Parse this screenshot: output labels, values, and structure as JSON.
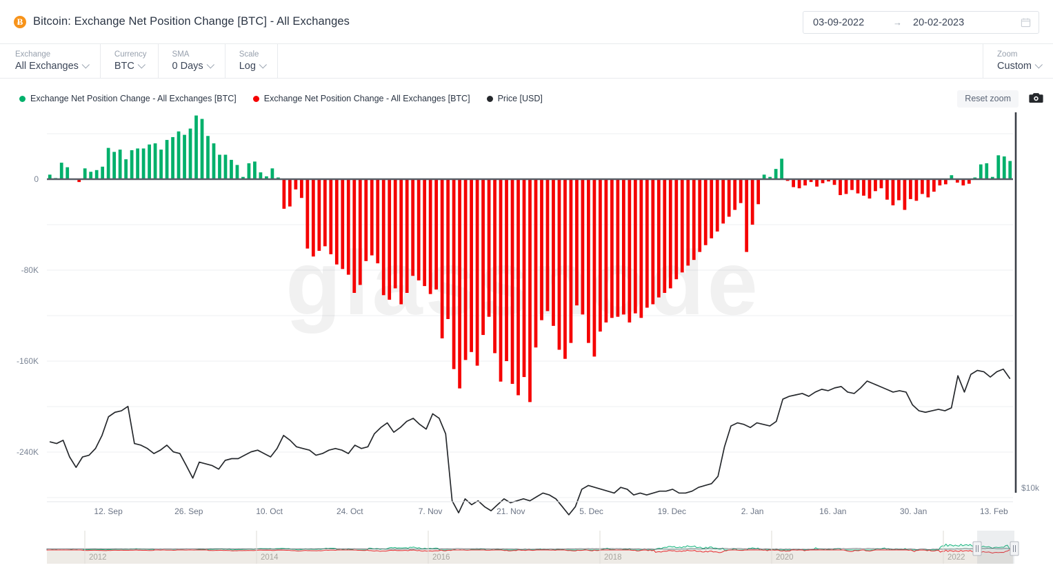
{
  "header": {
    "title": "Bitcoin: Exchange Net Position Change [BTC] - All Exchanges",
    "coin_symbol": "Ƀ"
  },
  "daterange": {
    "from": "03-09-2022",
    "to": "20-02-2023",
    "arrow": "→",
    "calendar_icon": "calendar-icon"
  },
  "controls": [
    {
      "label": "Exchange",
      "value": "All Exchanges"
    },
    {
      "label": "Currency",
      "value": "BTC"
    },
    {
      "label": "SMA",
      "value": "0 Days"
    },
    {
      "label": "Scale",
      "value": "Log"
    }
  ],
  "zoom_control": {
    "label": "Zoom",
    "value": "Custom"
  },
  "legend": [
    {
      "label": "Exchange Net Position Change - All Exchanges [BTC]",
      "color": "#00b06b"
    },
    {
      "label": "Exchange Net Position Change - All Exchanges [BTC]",
      "color": "#f50000"
    },
    {
      "label": "Price [USD]",
      "color": "#25282c"
    }
  ],
  "toolbar": {
    "reset_zoom_label": "Reset zoom",
    "camera_icon": "camera-icon"
  },
  "watermark": "glassnode",
  "chart_data": {
    "type": "bar",
    "title": "Bitcoin: Exchange Net Position Change [BTC] - All Exchanges",
    "xlabel": "",
    "ylabel": "",
    "ylim": [
      -280000,
      60000
    ],
    "yticks": [
      0,
      -80000,
      -160000,
      -240000
    ],
    "ytick_labels": [
      "0",
      "-80K",
      "-160K",
      "-240K"
    ],
    "xticks": [
      "12. Sep",
      "26. Sep",
      "10. Oct",
      "24. Oct",
      "7. Nov",
      "21. Nov",
      "5. Dec",
      "19. Dec",
      "2. Jan",
      "16. Jan",
      "30. Jan",
      "13. Feb"
    ],
    "grid": true,
    "legend_position": "top-left",
    "right_axis_label": "$10k",
    "series": [
      {
        "name": "Exchange Net Position Change - All Exchanges [BTC]",
        "type": "bar",
        "positive_color": "#00b06b",
        "negative_color": "#f50000",
        "values": [
          4000,
          1000,
          14500,
          10500,
          500,
          -2500,
          9500,
          6500,
          8000,
          11000,
          27500,
          24000,
          26000,
          17500,
          25500,
          27000,
          27000,
          30500,
          31500,
          26000,
          34500,
          37000,
          42000,
          39000,
          44500,
          56000,
          53000,
          38000,
          31500,
          21500,
          21500,
          17000,
          12500,
          2000,
          14000,
          15500,
          6000,
          2500,
          9500,
          1500,
          -26000,
          -24000,
          -9000,
          -16500,
          -61000,
          -68000,
          -63000,
          -59000,
          -66000,
          -75000,
          -79000,
          -84000,
          -100000,
          -93000,
          -72000,
          -67000,
          -74000,
          -102000,
          -106000,
          -96000,
          -110000,
          -100000,
          -85000,
          -89000,
          -94000,
          -101000,
          -97000,
          -140000,
          -123000,
          -167000,
          -184000,
          -159000,
          -152000,
          -164000,
          -137000,
          -121000,
          -153000,
          -178000,
          -160000,
          -180000,
          -190000,
          -174000,
          -196000,
          -148000,
          -124000,
          -116000,
          -129000,
          -150000,
          -158000,
          -144000,
          -111000,
          -119000,
          -144000,
          -156000,
          -134000,
          -126000,
          -122000,
          -121000,
          -119000,
          -126000,
          -118000,
          -122000,
          -113000,
          -110000,
          -104000,
          -100000,
          -96000,
          -88000,
          -82000,
          -76000,
          -71000,
          -64000,
          -58000,
          -52000,
          -46000,
          -39000,
          -33000,
          -27000,
          -21000,
          -64000,
          -40000,
          -22000,
          4000,
          2000,
          9000,
          18000,
          -1500,
          -7000,
          -8000,
          -5500,
          -2500,
          -6500,
          -3500,
          -2000,
          -5000,
          -14000,
          -13000,
          -9500,
          -12500,
          -14500,
          -17000,
          -10500,
          -8000,
          -18000,
          -23000,
          -18500,
          -27000,
          -17500,
          -19000,
          -13000,
          -16000,
          -11000,
          -5500,
          -4500,
          3500,
          -3000,
          -5500,
          -4000,
          1500,
          13000,
          14000,
          2000,
          21000,
          20000,
          16000
        ]
      },
      {
        "name": "Price [USD]",
        "type": "line",
        "color": "#25282c",
        "unit": "USD",
        "values": [
          19800,
          19700,
          19900,
          18900,
          18300,
          18900,
          19000,
          19400,
          20200,
          21400,
          21700,
          21800,
          22100,
          19700,
          19600,
          19400,
          19100,
          19300,
          19600,
          19200,
          19100,
          18400,
          17700,
          18600,
          18500,
          18400,
          18200,
          18700,
          18800,
          18800,
          19000,
          19200,
          19300,
          19100,
          18900,
          19400,
          20200,
          19900,
          19500,
          19400,
          19300,
          19000,
          19100,
          19300,
          19400,
          19300,
          19100,
          19600,
          19400,
          19500,
          20300,
          20700,
          21000,
          20400,
          20700,
          21100,
          21300,
          20900,
          20600,
          21600,
          21300,
          20300,
          16500,
          15900,
          16600,
          16300,
          16500,
          16200,
          16000,
          16300,
          16600,
          16400,
          16500,
          16600,
          16500,
          16700,
          16900,
          16800,
          16600,
          16200,
          15800,
          16200,
          17100,
          17300,
          17200,
          17100,
          17000,
          16900,
          17200,
          17100,
          16800,
          16900,
          16800,
          16900,
          17000,
          17000,
          17100,
          16900,
          16900,
          17000,
          17200,
          17300,
          17400,
          17800,
          19500,
          20800,
          21000,
          20900,
          20700,
          21000,
          20900,
          20800,
          21100,
          22600,
          22800,
          22900,
          23000,
          22800,
          23100,
          23300,
          23200,
          23400,
          23500,
          23100,
          23000,
          23400,
          23900,
          23700,
          23500,
          23300,
          23100,
          23200,
          23100,
          22200,
          21800,
          21700,
          21800,
          21900,
          21800,
          22000,
          24300,
          23100,
          24400,
          24700,
          24600,
          24200,
          24600,
          24800,
          24100
        ]
      }
    ]
  },
  "navigator": {
    "year_labels": [
      "2012",
      "2014",
      "2016",
      "2018",
      "2020",
      "2022"
    ],
    "handle_left_icon": "drag-handle-icon",
    "handle_right_icon": "drag-handle-icon"
  }
}
